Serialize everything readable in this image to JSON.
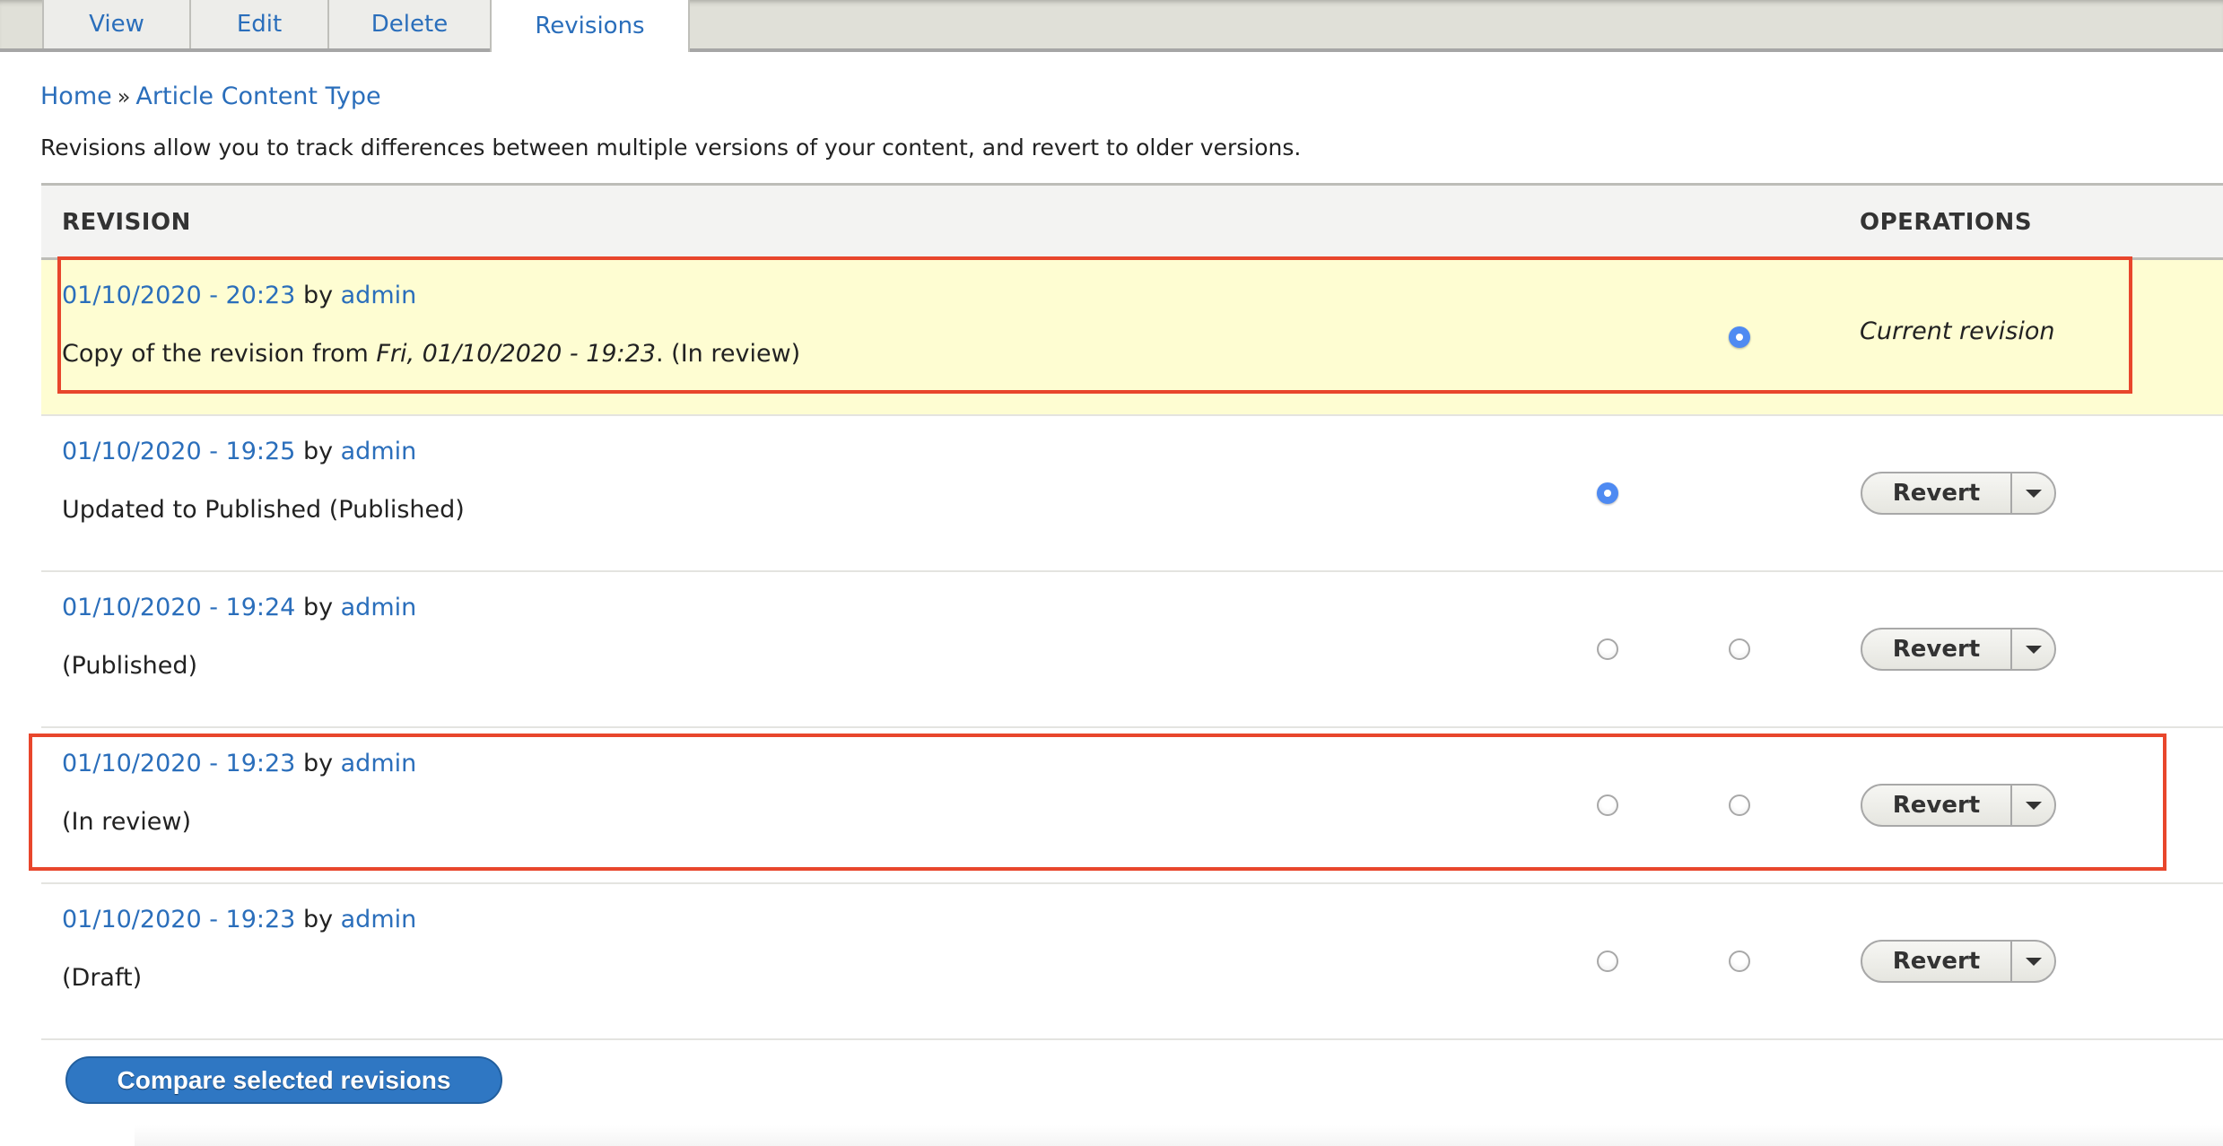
{
  "tabs": [
    {
      "label": "View",
      "active": false
    },
    {
      "label": "Edit",
      "active": false
    },
    {
      "label": "Delete",
      "active": false
    },
    {
      "label": "Revisions",
      "active": true
    }
  ],
  "breadcrumb": {
    "items": [
      "Home",
      "Article Content Type"
    ],
    "separator": "»"
  },
  "description": "Revisions allow you to track differences between multiple versions of your content, and revert to older versions.",
  "table": {
    "headers": {
      "revision": "REVISION",
      "operations": "OPERATIONS"
    },
    "rows": [
      {
        "date": "01/10/2020 - 20:23",
        "by": "by",
        "author": "admin",
        "message_prefix": "Copy of the revision from ",
        "message_italic": "Fri, 01/10/2020 - 19:23",
        "message_suffix": ". (In review)",
        "radio_left": null,
        "radio_right": "checked",
        "operation": "Current revision",
        "current": true,
        "highlighted": true
      },
      {
        "date": "01/10/2020 - 19:25",
        "by": "by",
        "author": "admin",
        "message": "Updated to Published (Published)",
        "radio_left": "checked",
        "radio_right": null,
        "operation": "Revert",
        "current": false,
        "highlighted": false
      },
      {
        "date": "01/10/2020 - 19:24",
        "by": "by",
        "author": "admin",
        "message": "(Published)",
        "radio_left": "unchecked",
        "radio_right": "unchecked",
        "operation": "Revert",
        "current": false,
        "highlighted": false
      },
      {
        "date": "01/10/2020 - 19:23",
        "by": "by",
        "author": "admin",
        "message": "(In review)",
        "radio_left": "unchecked",
        "radio_right": "unchecked",
        "operation": "Revert",
        "current": false,
        "highlighted": true
      },
      {
        "date": "01/10/2020 - 19:23",
        "by": "by",
        "author": "admin",
        "message": "(Draft)",
        "radio_left": "unchecked",
        "radio_right": "unchecked",
        "operation": "Revert",
        "current": false,
        "highlighted": false
      }
    ]
  },
  "compare_button": "Compare selected revisions",
  "colors": {
    "link": "#2a6ebb",
    "current_row_bg": "#fefdd2",
    "highlight_border": "#e8462c",
    "radio_checked": "#4e8af2",
    "primary_button": "#2f77c3"
  }
}
